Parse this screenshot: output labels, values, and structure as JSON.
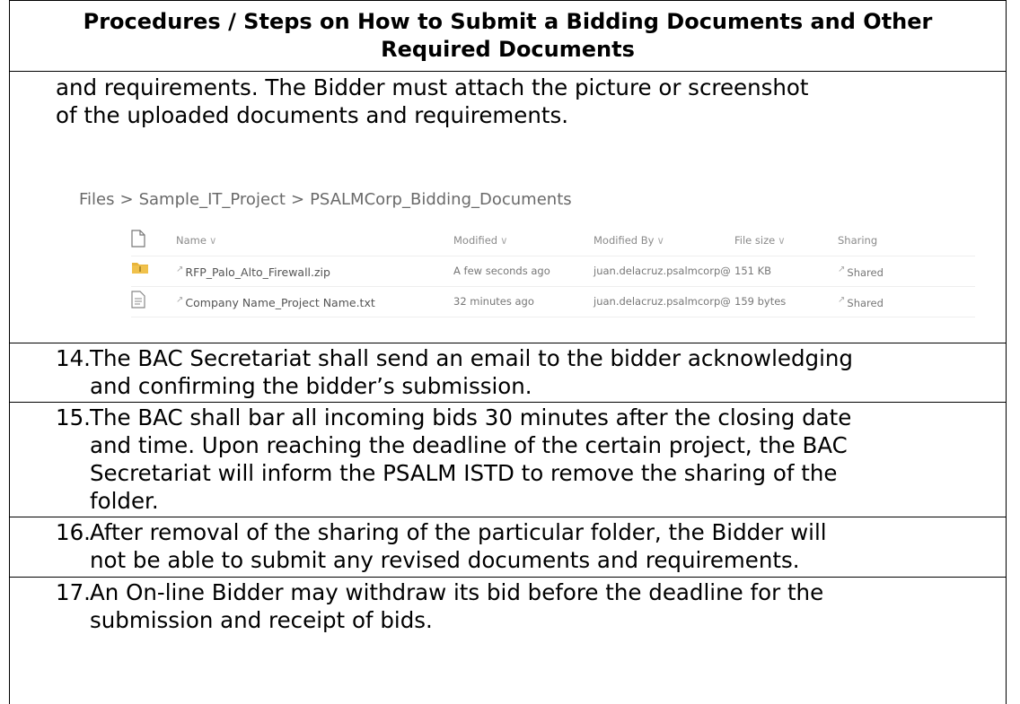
{
  "header": {
    "title_line1": "Procedures / Steps on How to Submit a Bidding Documents and Other",
    "title_line2": "Required Documents"
  },
  "continuation": {
    "line1": "and requirements. The Bidder must attach the picture or screenshot",
    "line2": "of the uploaded documents and requirements."
  },
  "screenshot": {
    "breadcrumb": [
      "Files",
      "Sample_IT_Project",
      "PSALMCorp_Bidding_Documents"
    ],
    "breadcrumb_separator": ">",
    "columns": [
      "Name",
      "Modified",
      "Modified By",
      "File size",
      "Sharing"
    ],
    "header_chevron": "∨",
    "rows": [
      {
        "name": "RFP_Palo_Alto_Firewall.zip",
        "modified": "A few seconds ago",
        "modified_by": "juan.delacruz.psalmcorp@",
        "size": "151 KB",
        "sharing": "Shared",
        "icon": "zip-folder-icon"
      },
      {
        "name": "Company Name_Project Name.txt",
        "modified": "32 minutes ago",
        "modified_by": "juan.delacruz.psalmcorp@",
        "size": "159 bytes",
        "sharing": "Shared",
        "icon": "text-file-icon"
      }
    ]
  },
  "items": [
    {
      "number": "14.",
      "line1": "The BAC Secretariat shall send an email to the bidder acknowledging",
      "line2": "and confirming the bidder’s submission."
    },
    {
      "number": "15.",
      "line1": "The BAC shall bar all incoming bids 30 minutes after the closing date",
      "line2": "and time. Upon reaching the deadline of the certain project, the BAC",
      "line3": "Secretariat will inform the PSALM ISTD to remove the sharing of the",
      "line4": "folder."
    },
    {
      "number": "16.",
      "line1": "After removal of the sharing of the particular folder, the Bidder will",
      "line2": "not be able to submit any revised documents and requirements."
    },
    {
      "number": "17.",
      "line1": "An On-line Bidder may withdraw its bid before the deadline for the",
      "line2": "submission and receipt of bids."
    }
  ]
}
